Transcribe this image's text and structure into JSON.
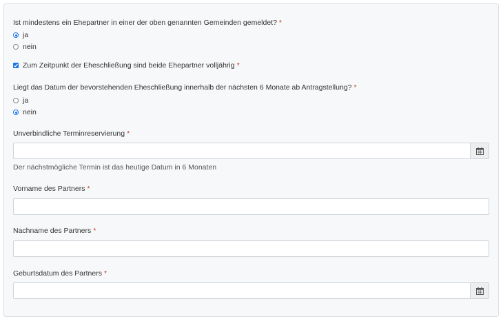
{
  "q1": {
    "label": "Ist mindestens ein Ehepartner in einer der oben genannten Gemeinden gemeldet?",
    "required": "*",
    "options": [
      {
        "label": "ja",
        "checked": true
      },
      {
        "label": "nein",
        "checked": false
      }
    ]
  },
  "q2": {
    "label": "Zum Zeitpunkt der Eheschließung sind beide Ehepartner volljährig",
    "required": "*",
    "checked": true
  },
  "q3": {
    "label": "Liegt das Datum der bevorstehenden Eheschließung innerhalb der nächsten 6 Monate ab Antragstellung?",
    "required": "*",
    "options": [
      {
        "label": "ja",
        "checked": false
      },
      {
        "label": "nein",
        "checked": true
      }
    ]
  },
  "reservation": {
    "label": "Unverbindliche Terminreservierung",
    "required": "*",
    "value": "",
    "help": "Der nächstmögliche Termin ist das heutige Datum in 6 Monaten",
    "button_icon": "calendar-icon"
  },
  "firstname": {
    "label": "Vorname des Partners",
    "required": "*",
    "value": ""
  },
  "lastname": {
    "label": "Nachname des Partners",
    "required": "*",
    "value": ""
  },
  "birthdate": {
    "label": "Geburtsdatum des Partners",
    "required": "*",
    "value": "",
    "button_icon": "calendar-icon"
  },
  "colors": {
    "accent": "#1a73e8",
    "required": "#c0392b",
    "panel_bg": "#f7f8f9"
  }
}
